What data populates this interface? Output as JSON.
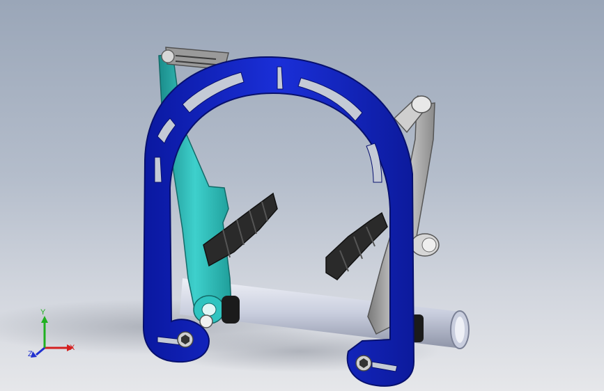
{
  "viewport": {
    "background_top": "#9aa6b8",
    "background_bottom": "#e6e7ea"
  },
  "model": {
    "frame_color": "#1224c8",
    "left_arm_color": "#2fc4c0",
    "right_arm_color": "#b8b8b8",
    "pad_color": "#2a2a2a",
    "tube_color": "#d8dce8"
  },
  "triad": {
    "x_label": "X",
    "y_label": "Y",
    "z_label": "Z",
    "x_color": "#d42020",
    "y_color": "#20b020",
    "z_color": "#2030d0"
  }
}
